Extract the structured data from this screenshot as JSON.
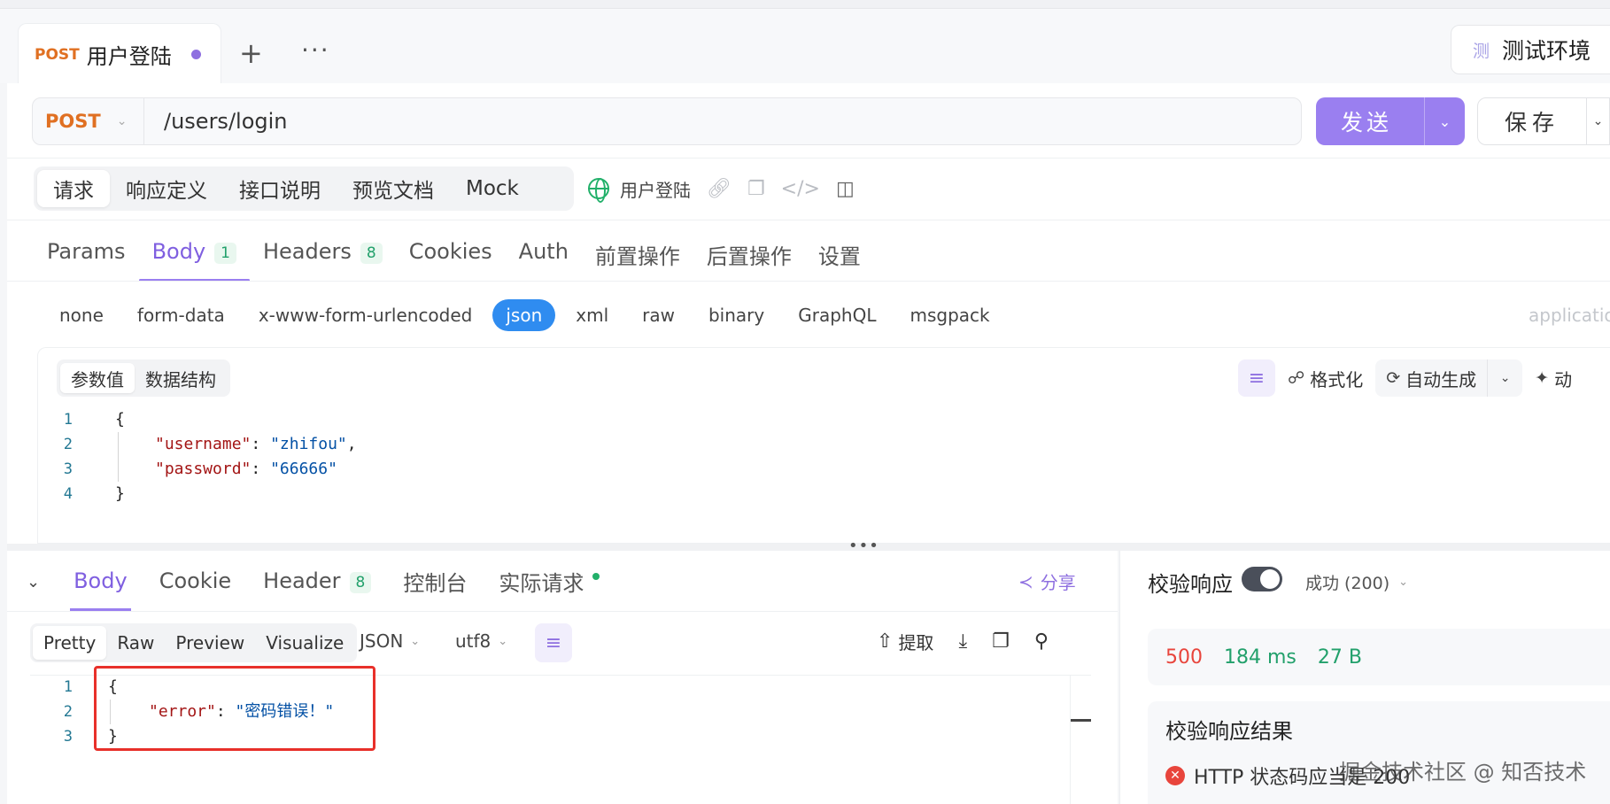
{
  "tabbar": {
    "active_tab": {
      "method": "POST",
      "title": "用户登陆"
    },
    "plus": "+",
    "more": "···",
    "env_badge": "测",
    "env_name": "测试环境"
  },
  "request": {
    "method": "POST",
    "url": "/users/login",
    "send_label": "发送",
    "save_label": "保存"
  },
  "view_tabs": [
    "请求",
    "响应定义",
    "接口说明",
    "预览文档",
    "Mock"
  ],
  "api_name": "用户登陆",
  "req_tabs": [
    {
      "label": "Params"
    },
    {
      "label": "Body",
      "badge": "1"
    },
    {
      "label": "Headers",
      "badge": "8"
    },
    {
      "label": "Cookies"
    },
    {
      "label": "Auth"
    },
    {
      "label": "前置操作"
    },
    {
      "label": "后置操作"
    },
    {
      "label": "设置"
    }
  ],
  "body_types": [
    "none",
    "form-data",
    "x-www-form-urlencoded",
    "json",
    "xml",
    "raw",
    "binary",
    "GraphQL",
    "msgpack"
  ],
  "content_type_hint": "applicatio",
  "editor": {
    "segments": [
      "参数值",
      "数据结构"
    ],
    "tools": {
      "format": "格式化",
      "autogen": "自动生成",
      "dynamic": "动"
    },
    "lines": [
      {
        "n": "1",
        "text": "{"
      },
      {
        "n": "2",
        "key": "\"username\"",
        "value": "\"zhifou\"",
        "trail": ","
      },
      {
        "n": "3",
        "key": "\"password\"",
        "value": "\"66666\"",
        "trail": ""
      },
      {
        "n": "4",
        "text": "}"
      }
    ]
  },
  "response": {
    "tabs": [
      {
        "label": "Body"
      },
      {
        "label": "Cookie"
      },
      {
        "label": "Header",
        "badge": "8"
      },
      {
        "label": "控制台"
      },
      {
        "label": "实际请求"
      }
    ],
    "share": "分享",
    "formats": [
      "Pretty",
      "Raw",
      "Preview",
      "Visualize"
    ],
    "lang": "JSON",
    "encoding": "utf8",
    "extract": "提取",
    "lines": [
      {
        "n": "1",
        "text": "{"
      },
      {
        "n": "2",
        "key": "\"error\"",
        "value": "\"密码错误！\""
      },
      {
        "n": "3",
        "text": "}"
      }
    ]
  },
  "verify": {
    "label": "校验响应",
    "select": "成功 (200)",
    "status_code": "500",
    "time": "184 ms",
    "size": "27 B",
    "result_title": "校验响应结果",
    "result_item": "HTTP 状态码应当是 200"
  },
  "watermark": "掘金技术社区 @ 知否技术",
  "colors": {
    "accent": "#9a7ff0",
    "method": "#e07022",
    "json_active": "#2f8cf0",
    "error": "#e8453c",
    "success": "#22a06b"
  }
}
